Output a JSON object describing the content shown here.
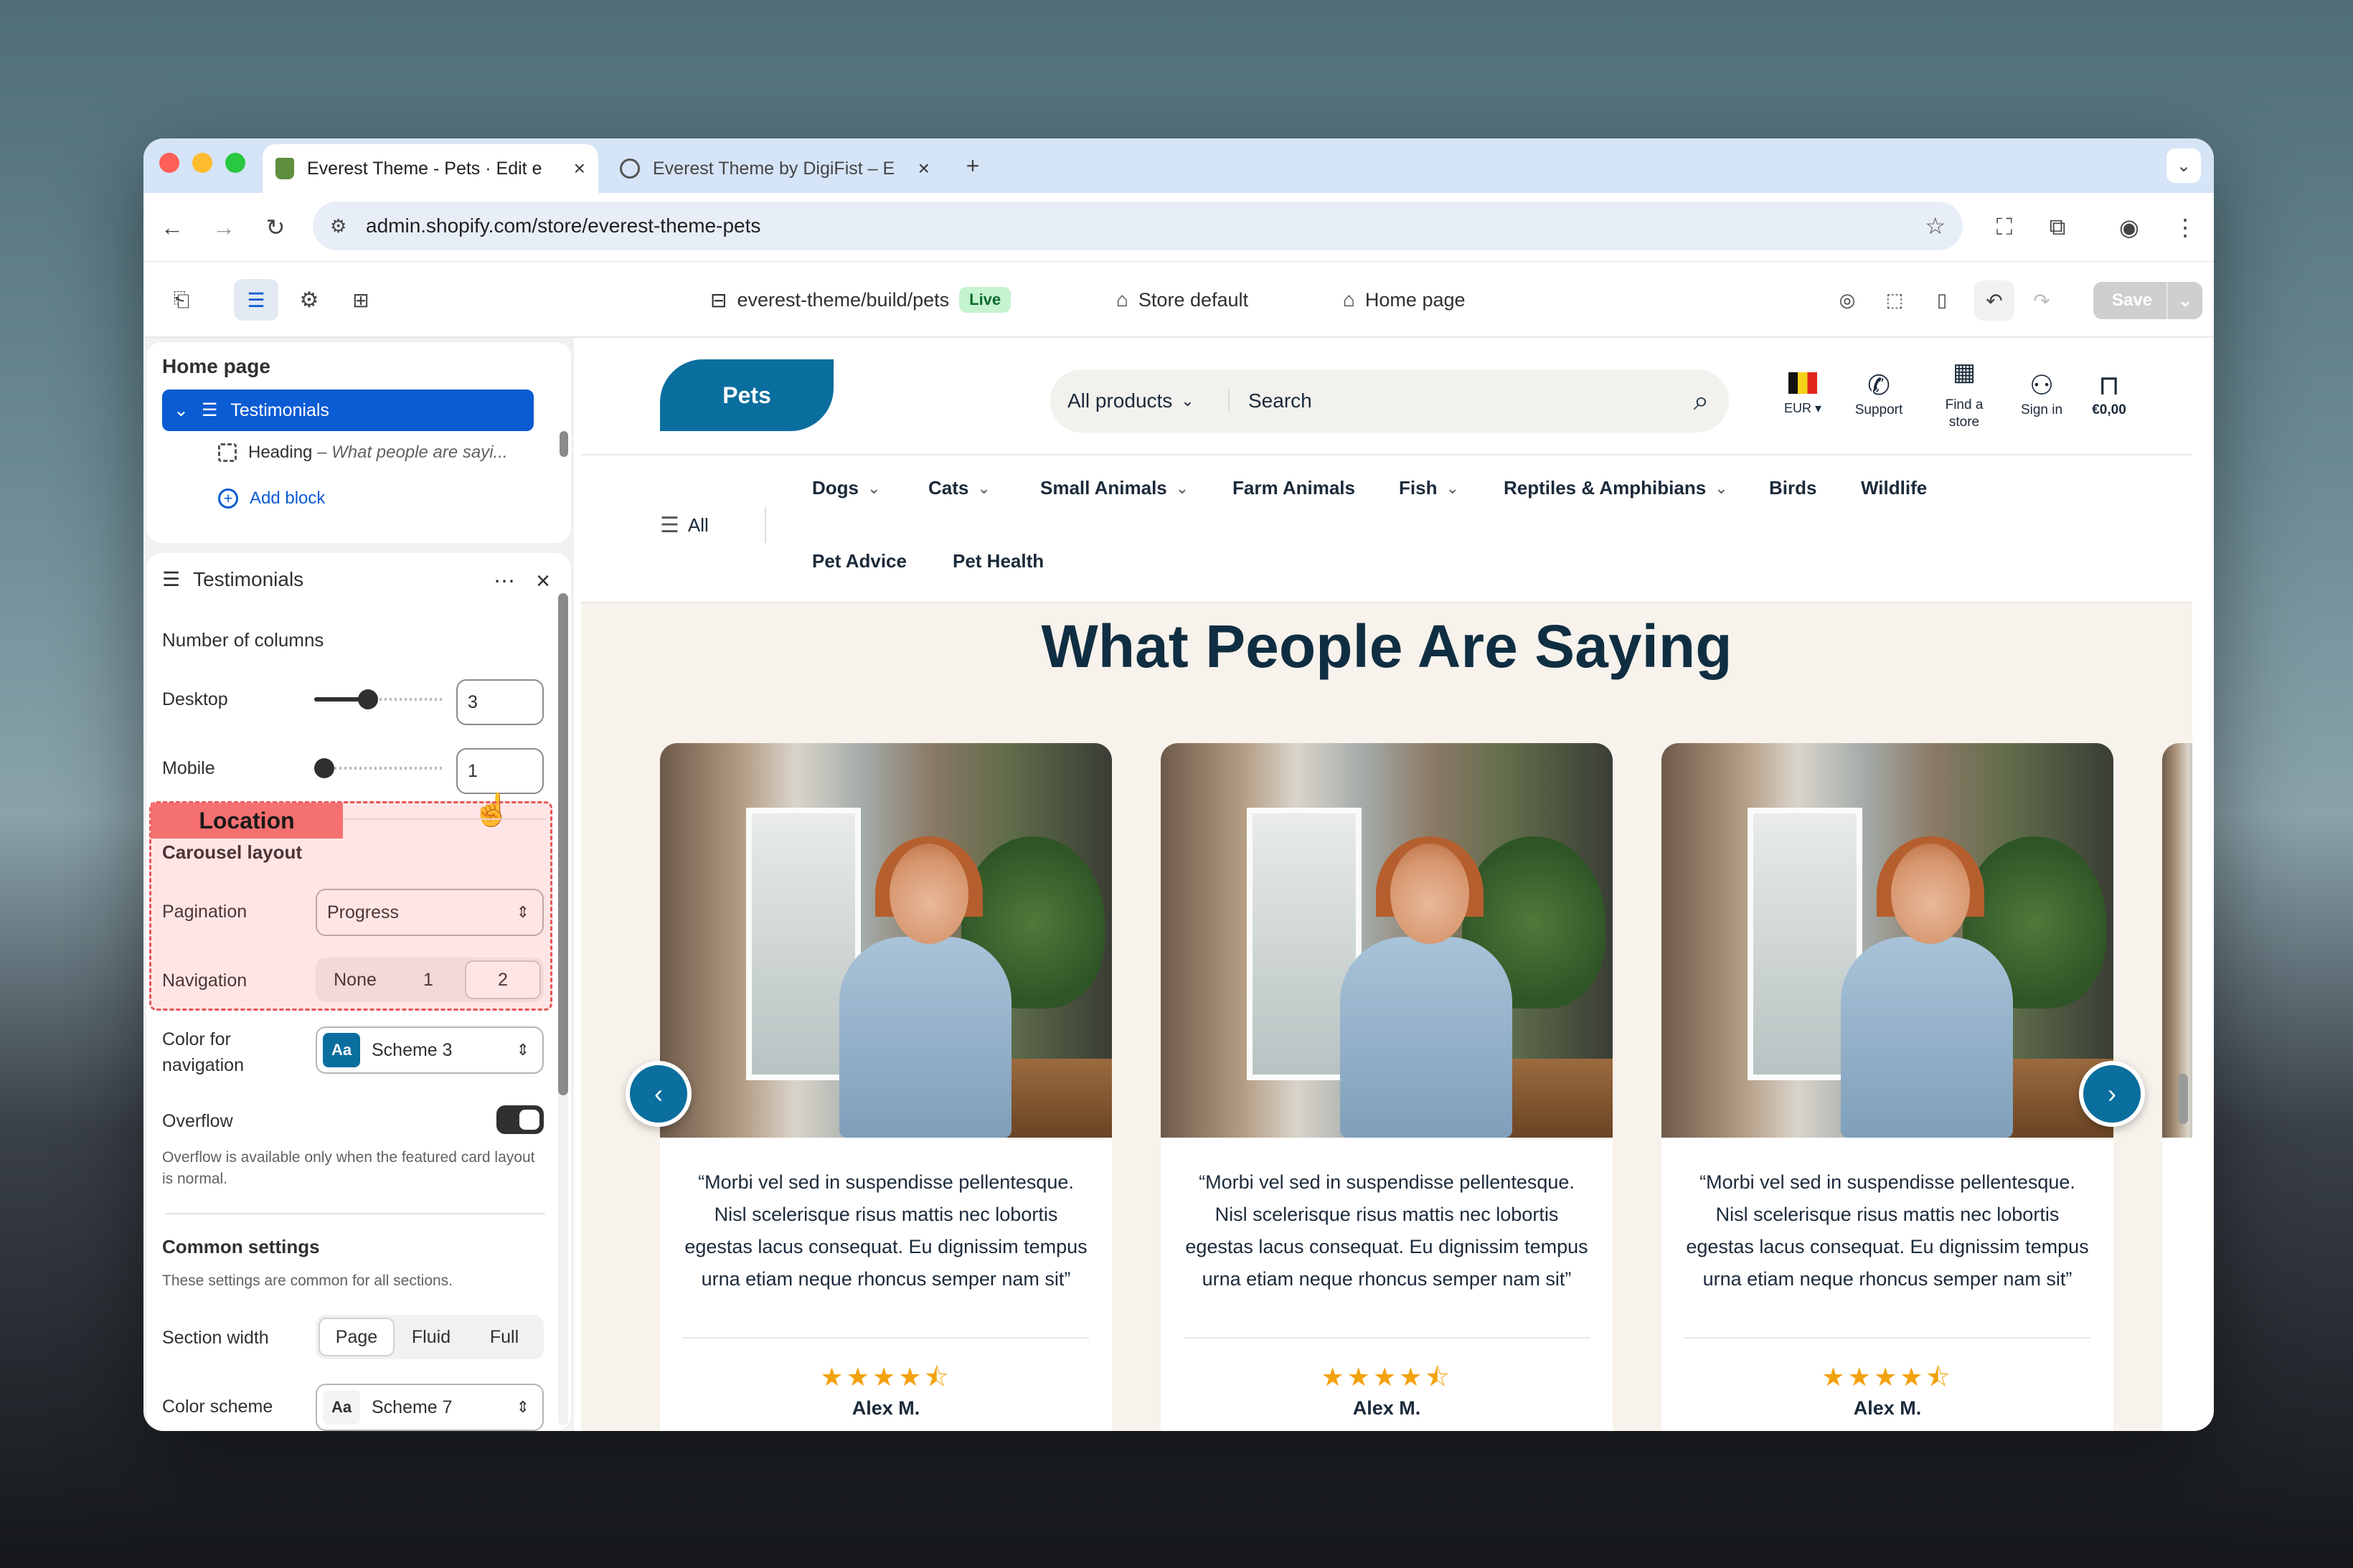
{
  "browser": {
    "tabs": [
      {
        "title": "Everest Theme - Pets · Edit e",
        "active": true
      },
      {
        "title": "Everest Theme by DigiFist – E",
        "active": false
      }
    ],
    "url": "admin.shopify.com/store/everest-theme-pets"
  },
  "editor_bar": {
    "theme_path": "everest-theme/build/pets",
    "live_badge": "Live",
    "store_default": "Store default",
    "page": "Home page",
    "save_label": "Save"
  },
  "sidebar": {
    "page_title": "Home page",
    "section_name": "Testimonials",
    "block_label": "Heading",
    "block_value": " – What people are sayi...",
    "add_block": "Add block",
    "settings_title": "Testimonials",
    "location_tag": "Location",
    "columns_heading": "Number of columns",
    "desktop_label": "Desktop",
    "desktop_value": "3",
    "desktop_fraction": 0.4,
    "mobile_label": "Mobile",
    "mobile_value": "1",
    "mobile_fraction": 0.0,
    "carousel_heading": "Carousel layout",
    "pagination_label": "Pagination",
    "pagination_value": "Progress",
    "navigation_label": "Navigation",
    "navigation_options": [
      "None",
      "1",
      "2"
    ],
    "navigation_selected": "2",
    "color_nav_label": "Color for navigation",
    "color_nav_value": "Scheme 3",
    "scheme_aa": "Aa",
    "overflow_label": "Overflow",
    "overflow_note": "Overflow is available only when the featured card layout is normal.",
    "common_heading": "Common settings",
    "common_note": "These settings are common for all sections.",
    "width_label": "Section width",
    "width_options": [
      "Page",
      "Fluid",
      "Full"
    ],
    "width_selected": "Page",
    "color_scheme_label": "Color scheme",
    "color_scheme_value": "Scheme 7"
  },
  "store": {
    "logo": "Pets",
    "search_category": "All products",
    "search_placeholder": "Search",
    "currency": "EUR",
    "support": "Support",
    "find_store": "Find a store",
    "sign_in": "Sign in",
    "cart_total": "€0,00",
    "all_menu": "All",
    "nav": [
      "Dogs",
      "Cats",
      "Small Animals",
      "Farm Animals",
      "Fish",
      "Reptiles & Amphibians",
      "Birds",
      "Wildlife",
      "Pet Advice",
      "Pet Health"
    ],
    "section_heading": "What People Are Saying",
    "testimonials": [
      {
        "quote": "“Morbi vel sed in suspendisse pellentesque. Nisl scelerisque risus mattis nec lobortis egestas lacus consequat. Eu dignissim tempus urna etiam neque rhoncus semper nam sit”",
        "rating": 4.5,
        "name": "Alex M."
      },
      {
        "quote": "“Morbi vel sed in suspendisse pellentesque. Nisl scelerisque risus mattis nec lobortis egestas lacus consequat. Eu dignissim tempus urna etiam neque rhoncus semper nam sit”",
        "rating": 4.5,
        "name": "Alex M."
      },
      {
        "quote": "“Morbi vel sed in suspendisse pellentesque. Nisl scelerisque risus mattis nec lobortis egestas lacus consequat. Eu dignissim tempus urna etiam neque rhoncus semper nam sit”",
        "rating": 4.5,
        "name": "Alex M."
      }
    ]
  },
  "colors": {
    "selected_blue": "#0b5bd3",
    "brand_blue": "#0a6e9e",
    "heading_navy": "#0f2e42",
    "star": "#f2a20f",
    "live_green": "#c6f3cf"
  }
}
